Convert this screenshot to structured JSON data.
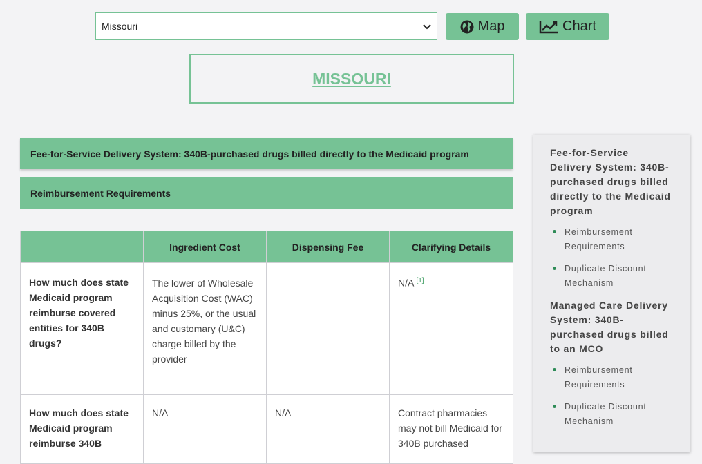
{
  "controls": {
    "state_selected": "Missouri",
    "map_label": "Map",
    "chart_label": "Chart"
  },
  "state_title": "MISSOURI",
  "sections": {
    "ffs_header": "Fee-for-Service Delivery System: 340B-purchased drugs billed directly to the Medicaid program",
    "reimbursement_header": "Reimbursement Requirements"
  },
  "table": {
    "headers": [
      "",
      "Ingredient Cost",
      "Dispensing Fee",
      "Clarifying Details"
    ],
    "rows": [
      {
        "question": "How much does state Medicaid program reimburse covered entities for 340B drugs?",
        "ingredient_cost": "The lower of Wholesale Acquisition Cost (WAC) minus 25%, or the usual and customary (U&C) charge billed by the provider",
        "dispensing_fee": "",
        "clarifying_details": "N/A",
        "footnote": "[1]"
      },
      {
        "question": "How much does state Medicaid program reimburse 340B",
        "ingredient_cost": "N/A",
        "dispensing_fee": "N/A",
        "clarifying_details": "Contract pharmacies may not bill Medicaid for 340B purchased"
      }
    ]
  },
  "sidebar": {
    "groups": [
      {
        "title": "Fee-for-Service Delivery System: 340B-purchased drugs billed directly to the Medicaid program",
        "items": [
          "Reimbursement Requirements",
          "Duplicate Discount Mechanism"
        ]
      },
      {
        "title": "Managed Care Delivery System: 340B-purchased drugs billed to an MCO",
        "items": [
          "Reimbursement Requirements",
          "Duplicate Discount Mechanism"
        ]
      }
    ]
  },
  "icons": {
    "map": "globe-icon",
    "chart": "line-chart-icon",
    "select": "chevron-down-icon"
  },
  "colors": {
    "accent": "#76c295",
    "background": "#f3f3f5",
    "bullet": "#2e8b57"
  }
}
